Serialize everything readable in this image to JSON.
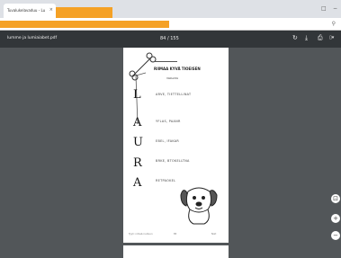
{
  "browser": {
    "tab_title": "Tuvalukelavaduu - Lu",
    "tab_close": "×",
    "window_min": "",
    "window_max": "□",
    "window_close": "−",
    "address_search_icon": "⚲"
  },
  "pdf_toolbar": {
    "filename": "lumme ja lumiaiabet.pdf",
    "page_indicator": "84 / 155",
    "rotate_icon": "↻",
    "download_icon": "⤓",
    "print_icon": "⎙",
    "more_icon": "▯▾"
  },
  "worksheet": {
    "title": "RIIMAA KYVÄ TIOEISEN",
    "subtitle": "Välilehtä",
    "rows": [
      {
        "letter": "L",
        "word": "ARVE, TIETTELLINAT"
      },
      {
        "letter": "A",
        "word": "YFLAS, PAANR"
      },
      {
        "letter": "U",
        "word": "EBEL, IFAKAR"
      },
      {
        "letter": "R",
        "word": "BRKE, BTOKELLTNA"
      },
      {
        "letter": "A",
        "word": "RETPAOKEL"
      }
    ],
    "footer_left": "Tyyli: nimeä ruutuun",
    "footer_center": "85",
    "footer_right": "Noit"
  },
  "zoom": {
    "fit_icon": "⊡",
    "zoom_in": "+",
    "zoom_out": "−"
  }
}
